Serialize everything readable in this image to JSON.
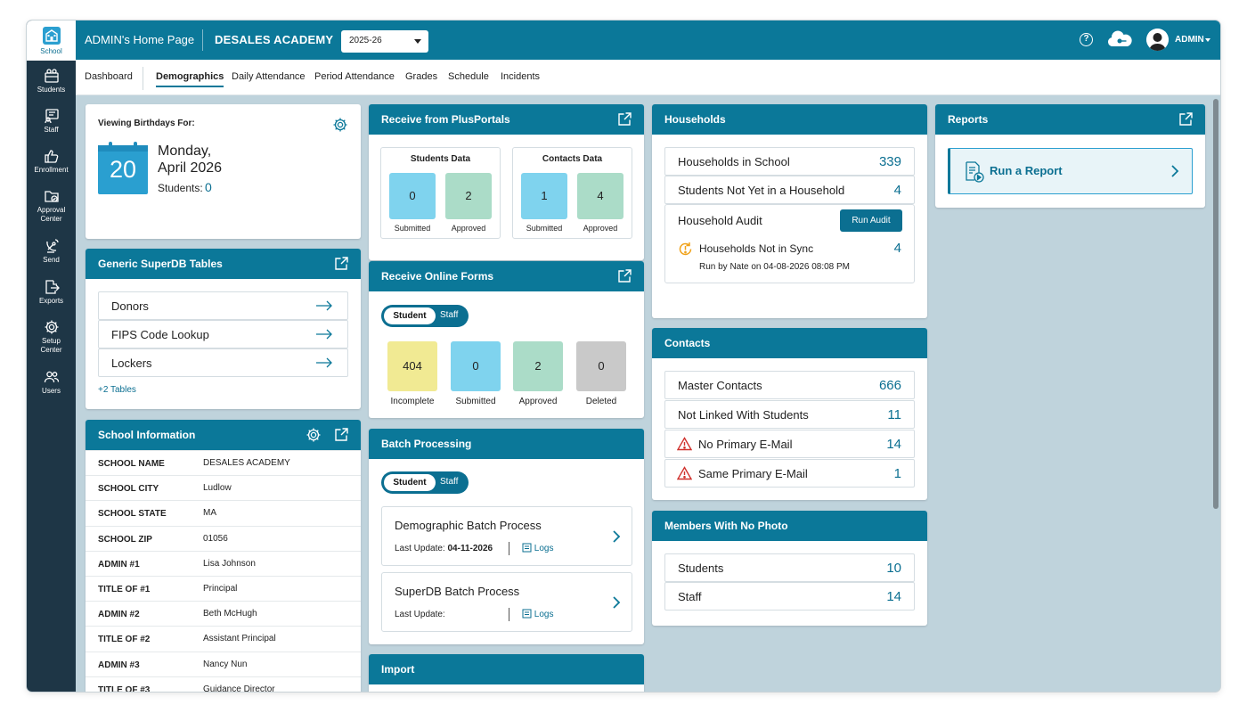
{
  "rail": [
    {
      "label": "School",
      "icon": "school-icon",
      "active": true
    },
    {
      "label": "Students",
      "icon": "students-icon"
    },
    {
      "label": "Staff",
      "icon": "staff-icon"
    },
    {
      "label": "Enrollment",
      "icon": "thumbs-up-icon"
    },
    {
      "label": "Approval Center",
      "icon": "folder-check-icon"
    },
    {
      "label": "Send",
      "icon": "satellite-icon"
    },
    {
      "label": "Exports",
      "icon": "export-icon"
    },
    {
      "label": "Setup Center",
      "icon": "gear-icon"
    },
    {
      "label": "Users",
      "icon": "users-icon"
    }
  ],
  "rail_labels": {
    "approval_1": "Approval",
    "approval_2": "Center",
    "setup_1": "Setup",
    "setup_2": "Center"
  },
  "topbar": {
    "title": "ADMIN's Home Page",
    "school": "DESALES ACADEMY",
    "year": "2025-26",
    "help": "?",
    "user": "ADMIN"
  },
  "tabs": [
    "Dashboard",
    "Demographics",
    "Daily Attendance",
    "Period Attendance",
    "Grades",
    "Schedule",
    "Incidents"
  ],
  "birthdays": {
    "heading": "Viewing Birthdays For:",
    "day": "20",
    "date_line1": "Monday,",
    "date_line2": "April 2026",
    "students_label": "Students:",
    "students_count": "0"
  },
  "superdb": {
    "title": "Generic SuperDB Tables",
    "items": [
      "Donors",
      "FIPS Code Lookup",
      "Lockers"
    ],
    "more": "+2 Tables"
  },
  "school_info": {
    "title": "School Information",
    "rows": [
      {
        "k": "SCHOOL NAME",
        "v": "DESALES ACADEMY"
      },
      {
        "k": "SCHOOL CITY",
        "v": "Ludlow"
      },
      {
        "k": "SCHOOL STATE",
        "v": "MA"
      },
      {
        "k": "SCHOOL ZIP",
        "v": "01056"
      },
      {
        "k": "ADMIN #1",
        "v": "Lisa Johnson"
      },
      {
        "k": "TITLE OF #1",
        "v": "Principal"
      },
      {
        "k": "ADMIN #2",
        "v": "Beth McHugh"
      },
      {
        "k": "TITLE OF #2",
        "v": "Assistant Principal"
      },
      {
        "k": "ADMIN #3",
        "v": "Nancy Nun"
      },
      {
        "k": "TITLE OF #3",
        "v": "Guidance Director"
      }
    ]
  },
  "plusportals": {
    "title": "Receive from PlusPortals",
    "students": {
      "label": "Students Data",
      "submitted": "0",
      "approved": "2"
    },
    "contacts": {
      "label": "Contacts Data",
      "submitted": "1",
      "approved": "4"
    },
    "submitted_label": "Submitted",
    "approved_label": "Approved"
  },
  "online_forms": {
    "title": "Receive Online Forms",
    "toggle_on": "Student",
    "toggle_off": "Staff",
    "tiles": [
      {
        "v": "404",
        "l": "Incomplete"
      },
      {
        "v": "0",
        "l": "Submitted"
      },
      {
        "v": "2",
        "l": "Approved"
      },
      {
        "v": "0",
        "l": "Deleted"
      }
    ]
  },
  "batch": {
    "title": "Batch Processing",
    "toggle_on": "Student",
    "toggle_off": "Staff",
    "items": [
      {
        "name": "Demographic Batch Process",
        "last_label": "Last Update:",
        "last_value": "04-11-2026",
        "logs": "Logs"
      },
      {
        "name": "SuperDB Batch Process",
        "last_label": "Last Update:",
        "last_value": "",
        "logs": "Logs"
      }
    ]
  },
  "import": {
    "title": "Import"
  },
  "households": {
    "title": "Households",
    "rows": [
      {
        "l": "Households in School",
        "v": "339"
      },
      {
        "l": "Students Not Yet in a Household",
        "v": "4"
      }
    ],
    "audit_label": "Household Audit",
    "audit_button": "Run Audit",
    "sync_label": "Households Not in Sync",
    "sync_value": "4",
    "run_by": "Run by Nate on",
    "run_date": "04-08-2026 08:08 PM"
  },
  "contacts": {
    "title": "Contacts",
    "rows": [
      {
        "l": "Master Contacts",
        "v": "666"
      },
      {
        "l": "Not Linked With Students",
        "v": "11"
      },
      {
        "l": "No Primary E-Mail",
        "v": "14",
        "warn": true
      },
      {
        "l": "Same Primary E-Mail",
        "v": "1",
        "warn": true
      }
    ]
  },
  "no_photo": {
    "title": "Members With No Photo",
    "rows": [
      {
        "l": "Students",
        "v": "10"
      },
      {
        "l": "Staff",
        "v": "14"
      }
    ]
  },
  "reports": {
    "title": "Reports",
    "run": "Run a Report"
  },
  "colors": {
    "brand": "#0b7899",
    "rail": "#1e3646",
    "blue_tile": "#7fd3ee",
    "green_tile": "#abdcc8",
    "yellow_tile": "#f1ea93",
    "gray_tile": "#c9c9c9",
    "warn": "#d0312d",
    "sync": "#f0a21a"
  }
}
